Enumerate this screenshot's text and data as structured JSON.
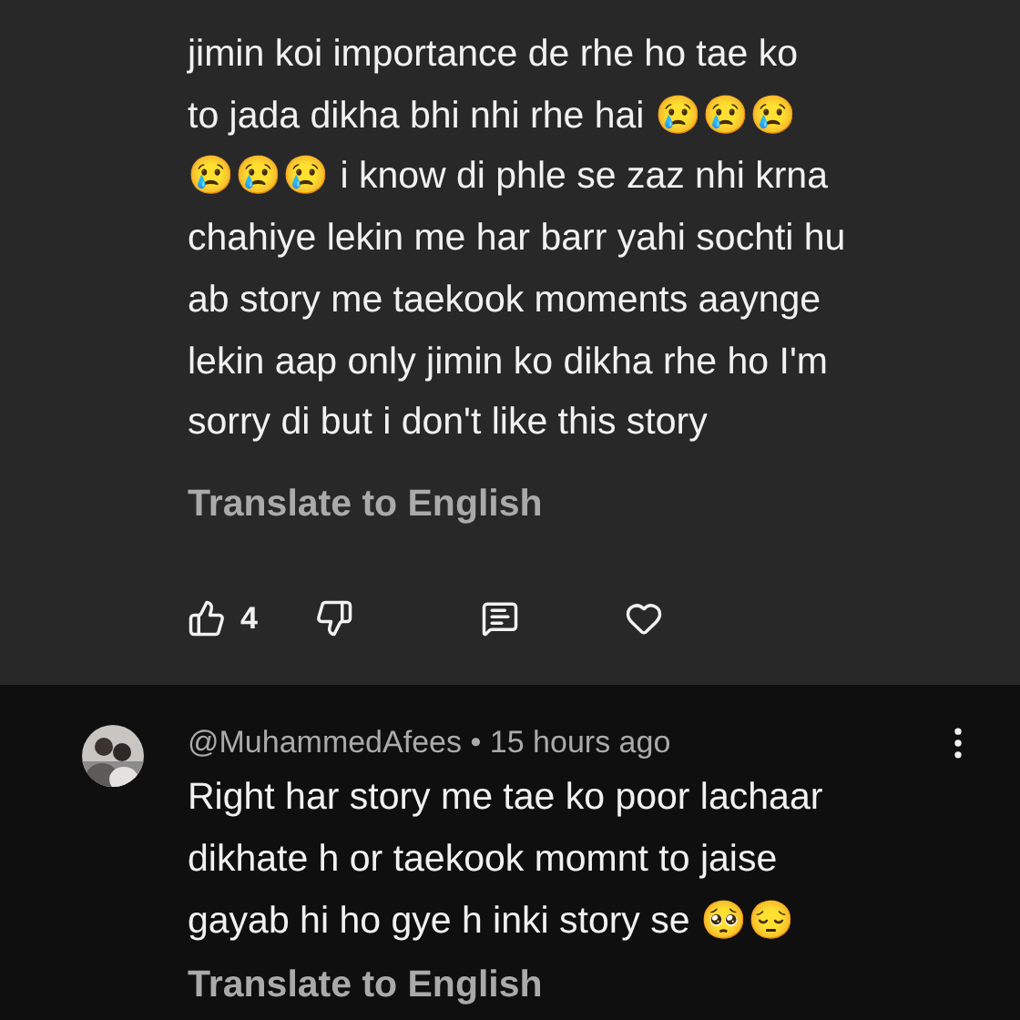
{
  "comments": [
    {
      "kind": "reply-open",
      "text": "jimin  koi importance de rhe ho tae ko\nto jada dikha bhi nhi rhe hai 😢😢😢\n😢😢😢 i know di phle se zaz nhi krna\nchahiye lekin me har barr yahi sochti hu\nab story me taekook moments aaynge\nlekin aap only jimin ko dikha rhe ho I'm\nsorry di  but i don't like this story",
      "translate": "Translate to English",
      "likes": "4",
      "selected": true
    },
    {
      "kind": "full",
      "author": "@MuhammedAfees",
      "separator": "•",
      "time": "15 hours ago",
      "text": "Right har story me tae ko poor lachaar\ndikhate h or taekook momnt to jaise\ngayab hi ho gye h inki story se 🥺😔",
      "translate": "Translate to English",
      "selected": false
    }
  ]
}
